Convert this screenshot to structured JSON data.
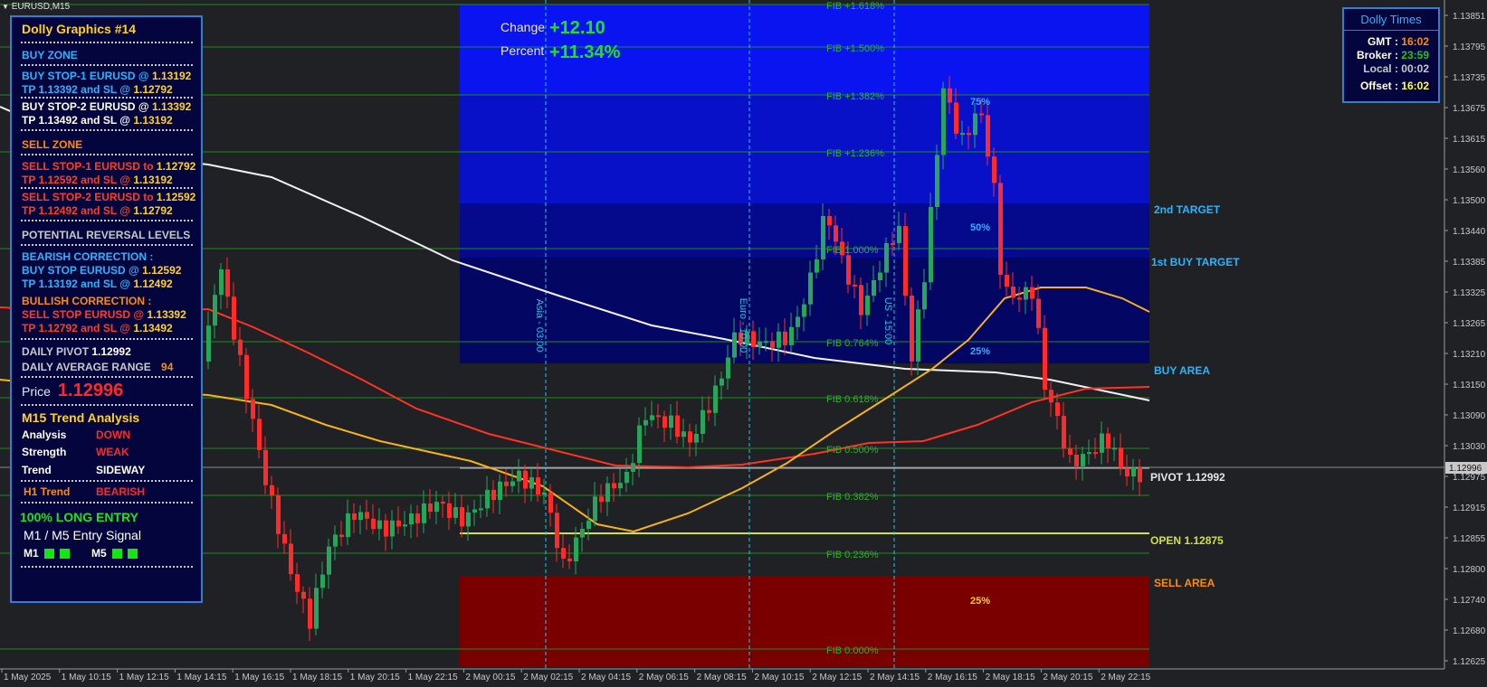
{
  "window_tab": "EURUSD,M15",
  "change": {
    "label": "Change",
    "value": "+12.10",
    "percent_label": "Percent",
    "percent_value": "+11.34%"
  },
  "panel": {
    "title": "Dolly Graphics #14",
    "buy_zone": "BUY ZONE",
    "bs1_a": "BUY STOP-1  EURUSD  @ ",
    "bs1_b": "1.13192",
    "bs1_tp": "TP 1.13392 and SL @ ",
    "bs1_sl": "1.12792",
    "bs2_a": "BUY STOP-2  EURUSD  @ ",
    "bs2_b": "1.13392",
    "bs2_tp": "TP 1.13492 and SL @ ",
    "bs2_sl": "1.13192",
    "sell_zone": "SELL ZONE",
    "ss1_a": "SELL STOP-1  EURUSD to ",
    "ss1_b": "1.12792",
    "ss1_tp": "TP 1.12592 and SL @ ",
    "ss1_sl": "1.13192",
    "ss2_a": "SELL STOP-2  EURUSD to ",
    "ss2_b": "1.12592",
    "ss2_tp": "TP 1.12492 and SL @ ",
    "ss2_sl": "1.12792",
    "reversal": "POTENTIAL REVERSAL LEVELS",
    "bearish": "BEARISH CORRECTION :",
    "bc_a": "BUY STOP EURUSD  @ ",
    "bc_b": "1.12592",
    "bc_tp": "TP 1.13192 and SL @ ",
    "bc_sl": "1.12492",
    "bullish": "BULLISH CORRECTION :",
    "uc_a": "SELL STOP EURUSD  @ ",
    "uc_b": "1.13392",
    "uc_tp": "TP 1.12792 and SL @ ",
    "uc_sl": "1.13492",
    "pivot_label": "DAILY PIVOT ",
    "pivot_value": "1.12992",
    "range_label": "DAILY AVERAGE RANGE ",
    "range_value": "94",
    "price_label": "Price",
    "price_value": "1.12996",
    "trend_title": "M15 Trend Analysis",
    "analysis_label": "Analysis",
    "analysis_value": "DOWN",
    "strength_label": "Strength",
    "strength_value": "WEAK",
    "trend_label": "Trend",
    "trend_value": "SIDEWAY",
    "h1_label": "H1 Trend",
    "h1_value": "BEARISH",
    "long_entry": "100% LONG ENTRY",
    "entry_signal": "M1 /  M5 Entry Signal",
    "m1": "M1",
    "m5": "M5"
  },
  "times": {
    "title": "Dolly Times",
    "gmt_label": "GMT :",
    "gmt": "16:02",
    "broker_label": "Broker :",
    "broker": "23:59",
    "local_label": "Local :",
    "local": "00:02",
    "offset_label": "Offset :",
    "offset": "16:02"
  },
  "fib_labels": [
    "FIB +1.618%",
    "FIB +1.500%",
    "FIB +1.382%",
    "FIB +1.236%",
    "FIB 1.000%",
    "FIB 0.764%",
    "FIB 0.618%",
    "FIB 0.500%",
    "FIB 0.382%",
    "FIB 0.236%",
    "FIB 0.000%"
  ],
  "zone_labels": {
    "second_target": "2nd TARGET",
    "first_target": "1st BUY TARGET",
    "buy_area": "BUY AREA",
    "pivot": "PIVOT 1.12992",
    "open": "OPEN 1.12875",
    "sell_area": "SELL AREA",
    "pct75": "75%",
    "pct50": "50%",
    "pct25_up": "25%",
    "pct25_down": "25%"
  },
  "sessions": [
    "Asia - 03:00",
    "Euro - 10:00",
    "US - 15:00"
  ],
  "price_axis": [
    "1.13851",
    "1.13795",
    "1.13735",
    "1.13675",
    "1.13615",
    "1.13560",
    "1.13500",
    "1.13440",
    "1.13385",
    "1.13325",
    "1.13265",
    "1.13210",
    "1.13150",
    "1.13090",
    "1.13030",
    "1.12975",
    "1.12915",
    "1.12855",
    "1.12800",
    "1.12740",
    "1.12680",
    "1.12625"
  ],
  "current_price_tag": "1.12996",
  "time_axis": [
    "1 May 2025",
    "1 May 10:15",
    "1 May 12:15",
    "1 May 14:15",
    "1 May 16:15",
    "1 May 18:15",
    "1 May 20:15",
    "1 May 22:15",
    "2 May 00:15",
    "2 May 02:15",
    "2 May 04:15",
    "2 May 06:15",
    "2 May 08:15",
    "2 May 10:15",
    "2 May 12:15",
    "2 May 14:15",
    "2 May 16:15",
    "2 May 18:15",
    "2 May 20:15",
    "2 May 22:15"
  ],
  "colors": {
    "bull": "#26a65b",
    "bear": "#ff2a2a",
    "fib": "#1f8a1f",
    "buy_zone": "#0000ff",
    "sell_zone": "#7a0000",
    "session": "#1fc8e8"
  }
}
